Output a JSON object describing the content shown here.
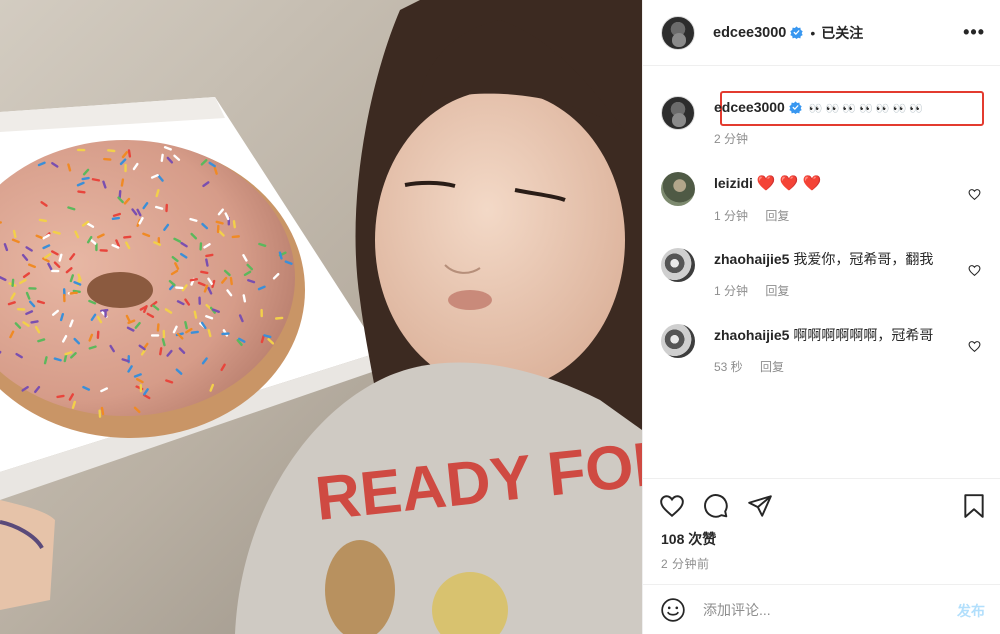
{
  "post": {
    "author": "edcee3000",
    "follow_separator": "•",
    "follow_status": "已关注",
    "more_glyph": "•••"
  },
  "caption": {
    "author": "edcee3000",
    "text": "👀 👀 👀 👀 👀 👀 👀",
    "time": "2 分钟",
    "highlight_color": "#e33b2f"
  },
  "comments": [
    {
      "author": "leizidi",
      "text": "❤️ ❤️ ❤️",
      "time": "1 分钟",
      "reply": "回复"
    },
    {
      "author": "zhaohaijie5",
      "text": "我爱你，冠希哥，翻我",
      "time": "1 分钟",
      "reply": "回复"
    },
    {
      "author": "zhaohaijie5",
      "text": "啊啊啊啊啊啊，冠希哥",
      "time": "53 秒",
      "reply": "回复"
    }
  ],
  "likes": "108 次赞",
  "posted_time": "2 分钟前",
  "composer": {
    "placeholder": "添加评论...",
    "post_label": "发布",
    "post_color": "#b2dffc"
  },
  "photo": {
    "shirt_text": "READY FOR"
  },
  "icons": [
    "heart-icon",
    "comment-icon",
    "share-icon",
    "bookmark-icon",
    "emoji-icon",
    "verified-badge-icon",
    "more-options-icon"
  ]
}
